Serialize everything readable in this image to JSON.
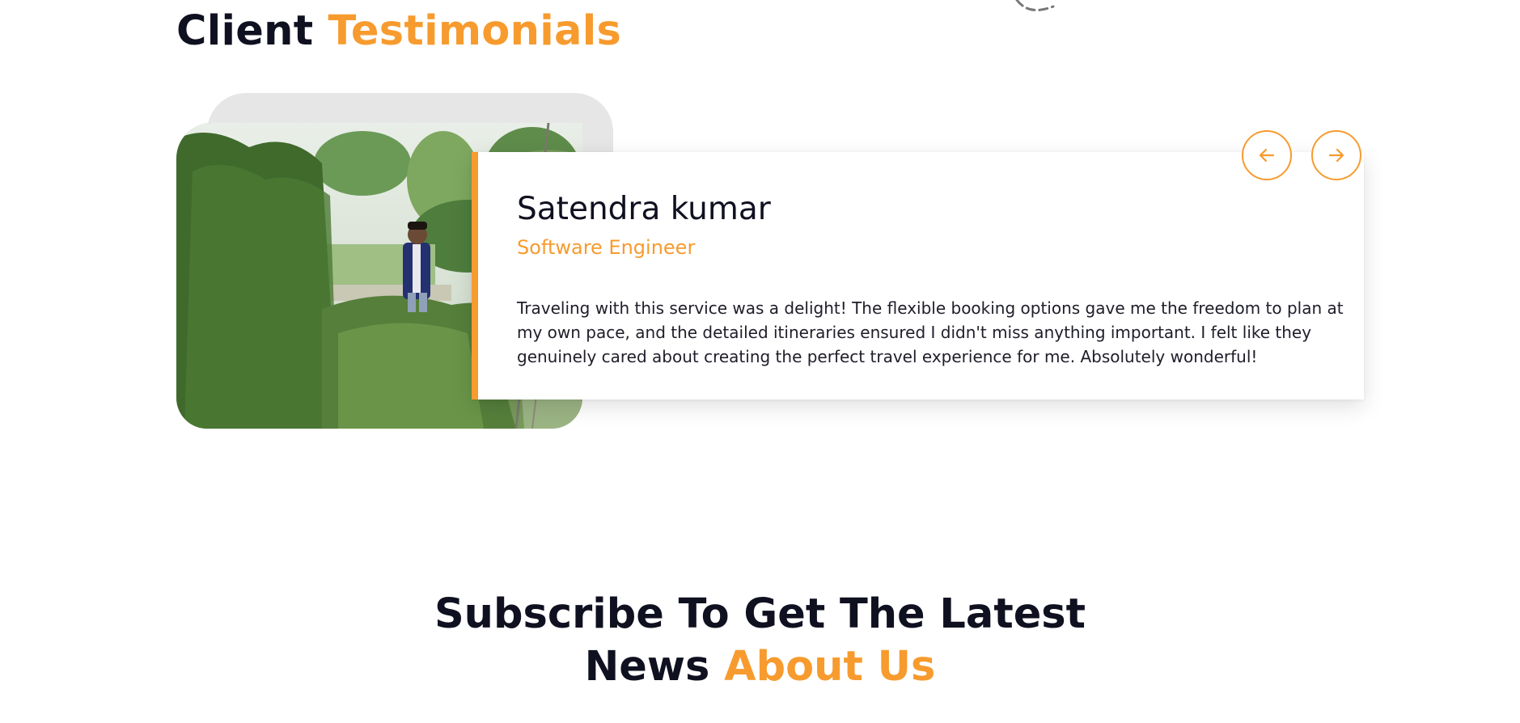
{
  "testimonials": {
    "title_plain": "Client",
    "title_accent": "Testimonials",
    "prev_icon": "arrow-left-icon",
    "next_icon": "arrow-right-icon",
    "current": {
      "name": "Satendra kumar",
      "role": "Software Engineer",
      "quote": "Traveling with this service was a delight! The flexible booking options gave me the freedom to plan at my own pace, and the detailed itineraries ensured I didn't miss anything important. I felt like they genuinely cared about creating the perfect travel experience for me. Absolutely wonderful!"
    }
  },
  "subscribe": {
    "line1": "Subscribe To Get The Latest",
    "line2_plain": "News",
    "line2_accent": "About Us"
  },
  "colors": {
    "accent": "#f79b2e",
    "heading": "#0f1020",
    "card_background": "#ffffff",
    "photo_back": "#e6e6e6"
  }
}
